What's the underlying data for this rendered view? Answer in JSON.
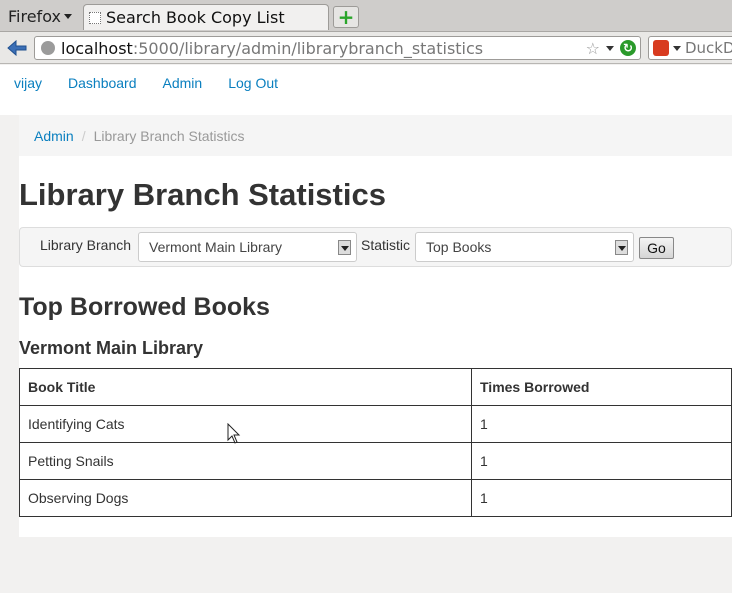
{
  "browser": {
    "menu_label": "Firefox",
    "tab_title": "Search Book Copy List",
    "url_host": "localhost",
    "url_path": ":5000/library/admin/librarybranch_statistics",
    "search_engine_label": "DuckD"
  },
  "nav": {
    "user": "vijay",
    "dashboard": "Dashboard",
    "admin": "Admin",
    "logout": "Log Out"
  },
  "breadcrumb": {
    "parent": "Admin",
    "current": "Library Branch Statistics"
  },
  "page": {
    "title": "Library Branch Statistics"
  },
  "filters": {
    "branch_label": "Library Branch",
    "branch_value": "Vermont Main Library",
    "statistic_label": "Statistic",
    "statistic_value": "Top Books",
    "go_label": "Go"
  },
  "results": {
    "heading": "Top Borrowed Books",
    "subheading": "Vermont Main Library",
    "columns": [
      "Book Title",
      "Times Borrowed"
    ],
    "rows": [
      [
        "Identifying Cats",
        "1"
      ],
      [
        "Petting Snails",
        "1"
      ],
      [
        "Observing Dogs",
        "1"
      ]
    ]
  }
}
